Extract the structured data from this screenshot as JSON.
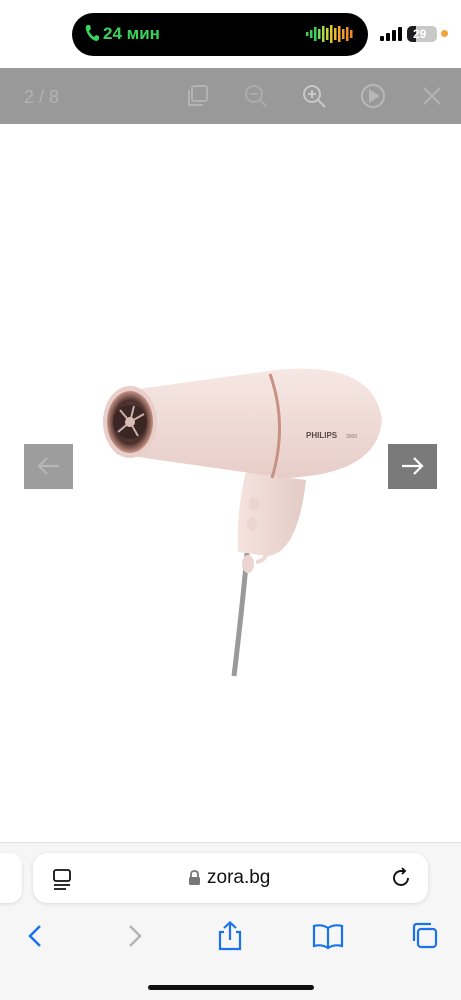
{
  "status_bar": {
    "call_duration": "24 мин",
    "battery_level": "29",
    "battery_fraction": 0.29
  },
  "lightbox": {
    "counter": "2 / 8",
    "icons": [
      "copy-icon",
      "zoom-out-icon",
      "zoom-in-icon",
      "play-icon",
      "close-icon"
    ]
  },
  "product": {
    "brand": "PHILIPS",
    "model": "3000"
  },
  "browser": {
    "domain": "zora.bg"
  },
  "colors": {
    "toolbar_bg": "#999999",
    "scroll_top_bg": "#1e9aa3",
    "call_green": "#3ad35a",
    "ios_blue": "#1a73e8",
    "dryer_pink": "#f1dcd8",
    "dryer_rose_gold": "#c79184"
  }
}
